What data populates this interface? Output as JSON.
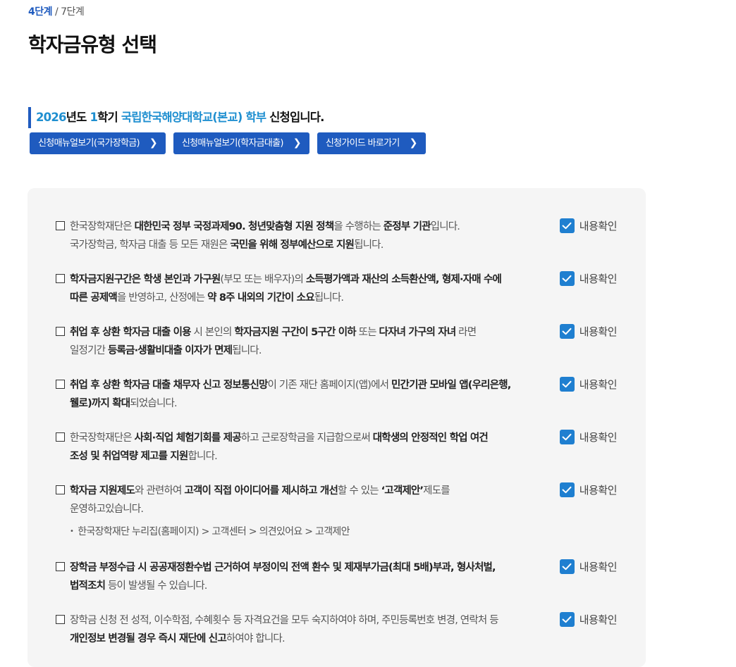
{
  "step": {
    "current": "4단계",
    "separator": " / ",
    "total": "7단계"
  },
  "page_title": "학자금유형 선택",
  "notice": {
    "year": "2026",
    "year_suffix": "년도 ",
    "term": "1",
    "term_suffix": "학기 ",
    "school": "국립한국해양대학교(본교) 학부",
    "tail": " 신청입니다."
  },
  "buttons": [
    {
      "label": "신청매뉴얼보기(국가장학금)"
    },
    {
      "label": "신청매뉴얼보기(학자금대출)"
    },
    {
      "label": "신청가이드 바로가기"
    }
  ],
  "confirm_label": "내용확인",
  "colors": {
    "primary": "#1f5bbf",
    "accent": "#1f8fd0",
    "check": "#1f7fd0",
    "panel_bg": "#f5f5f5"
  },
  "items": [
    {
      "parts": [
        {
          "t": "한국장학재단은 "
        },
        {
          "t": "대한민국 정부 국정과제90. 청년맞춤형 지원 정책",
          "b": true
        },
        {
          "t": "을 수행하는 "
        },
        {
          "t": "준정부 기관",
          "b": true
        },
        {
          "t": "입니다."
        },
        {
          "br": true
        },
        {
          "t": "국가장학금, 학자금 대출 등 모든 재원은 "
        },
        {
          "t": "국민을 위해 정부예산으로 지원",
          "b": true
        },
        {
          "t": "됩니다."
        }
      ]
    },
    {
      "parts": [
        {
          "t": "학자금지원구간은 학생 본인과 가구원",
          "b": true
        },
        {
          "t": "(부모 또는 배우자)의 "
        },
        {
          "t": "소득평가액과 재산의 소득환산액, 형제·자매 수에",
          "b": true
        },
        {
          "br": true
        },
        {
          "t": "따른 공제액",
          "b": true
        },
        {
          "t": "을 반영하고, 산정에는 "
        },
        {
          "t": "약 8주 내외의 기간이 소요",
          "b": true
        },
        {
          "t": "됩니다."
        }
      ]
    },
    {
      "parts": [
        {
          "t": "취업 후 상환 학자금 대출 이용",
          "b": true
        },
        {
          "t": " 시 본인의 "
        },
        {
          "t": "학자금지원 구간이 5구간 이하",
          "b": true
        },
        {
          "t": " 또는 "
        },
        {
          "t": "다자녀 가구의 자녀",
          "b": true
        },
        {
          "t": " 라면"
        },
        {
          "br": true
        },
        {
          "t": "일정기간 "
        },
        {
          "t": "등록금·생활비대출 이자가 면제",
          "b": true
        },
        {
          "t": "됩니다."
        }
      ]
    },
    {
      "parts": [
        {
          "t": "취업 후 상환 학자금 대출 채무자 신고 정보통신망",
          "b": true
        },
        {
          "t": "이 기존 재단 홈페이지(앱)에서 "
        },
        {
          "t": "민간기관 모바일 앱(우리은행,",
          "b": true
        },
        {
          "br": true
        },
        {
          "t": "웰로)까지 확대",
          "b": true
        },
        {
          "t": "되었습니다."
        }
      ]
    },
    {
      "parts": [
        {
          "t": "한국장학재단은 "
        },
        {
          "t": "사회·직업 체험기회를 제공",
          "b": true
        },
        {
          "t": "하고 근로장학금을 지급함으로써 "
        },
        {
          "t": "대학생의 안정적인 학업 여건",
          "b": true
        },
        {
          "br": true
        },
        {
          "t": "조성 및 취업역량 제고를 지원",
          "b": true
        },
        {
          "t": "합니다."
        }
      ]
    },
    {
      "parts": [
        {
          "t": "학자금 지원제도",
          "b": true
        },
        {
          "t": "와 관련하여 "
        },
        {
          "t": "고객이 직접 아이디어를 제시하고 개선",
          "b": true
        },
        {
          "t": "할 수 있는 "
        },
        {
          "t": "‘고객제안’",
          "b": true
        },
        {
          "t": "제도를"
        },
        {
          "br": true
        },
        {
          "t": "운영하고있습니다."
        }
      ],
      "sub": "한국장학재단 누리집(홈페이지) > 고객센터 > 의견있어요 > 고객제안"
    },
    {
      "parts": [
        {
          "t": "장학금 부정수급 시 공공재정환수법 근거하여 부정이익 전액 환수 및 제재부가금(최대 5배)부과, 형사처벌,",
          "b": true
        },
        {
          "br": true
        },
        {
          "t": "법적조치",
          "b": true
        },
        {
          "t": " 등이 발생될 수 있습니다."
        }
      ]
    },
    {
      "parts": [
        {
          "t": "장학금 신청 전 성적, 이수학점, 수혜횟수 등 자격요건을 모두 숙지하여야 하며, 주민등록번호 변경, 연락처 등"
        },
        {
          "br": true
        },
        {
          "t": "개인정보 변경될 경우 즉시 재단에 신고",
          "b": true
        },
        {
          "t": "하여야 합니다."
        }
      ]
    }
  ]
}
